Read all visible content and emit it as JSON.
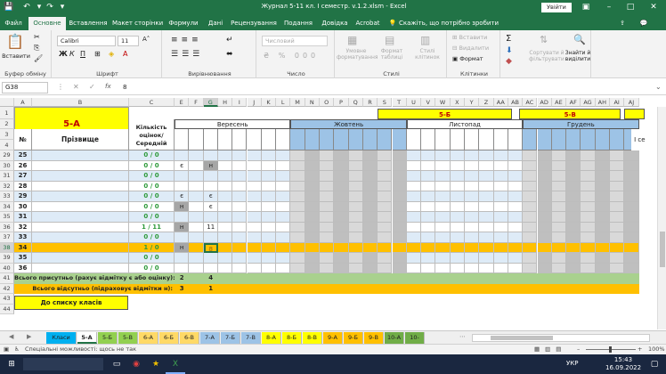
{
  "window": {
    "title": "Журнал 5-11 кл. I семестр. v.1.2.xlsm  -  Excel",
    "signin": "Увійти"
  },
  "ribbon_tabs": [
    "Файл",
    "Основне",
    "Вставлення",
    "Макет сторінки",
    "Формули",
    "Дані",
    "Рецензування",
    "Подання",
    "Довідка",
    "Acrobat"
  ],
  "tell_me": "Скажіть, що потрібно зробити",
  "ribbon": {
    "paste": "Вставити",
    "clipboard": "Буфер обміну",
    "font_name": "Calibri",
    "font_size": "11",
    "font": "Шрифт",
    "alignment": "Вирівнювання",
    "number_format": "Числовий",
    "number": "Число",
    "cond_format": "Умовне форматування",
    "format_table": "Формат таблиці",
    "cell_styles": "Стилі клітинок",
    "styles": "Стилі",
    "insert": "Вставити",
    "delete": "Видалити",
    "format": "Формат",
    "cells": "Клітинки",
    "sort": "Сортувати й фільтрувати",
    "find": "Знайти й виділити"
  },
  "formula_bar": {
    "name_box": "G38",
    "fx": "fx",
    "value": "8"
  },
  "columns": [
    "A",
    "B",
    "C",
    "E",
    "F",
    "G",
    "H",
    "I",
    "J",
    "K",
    "L",
    "M",
    "N",
    "O",
    "P",
    "Q",
    "R",
    "S",
    "T",
    "U",
    "V",
    "W",
    "X",
    "Y",
    "Z",
    "AA",
    "AB",
    "AC",
    "AD",
    "AE",
    "AF",
    "AG",
    "AH",
    "AI",
    "AJ"
  ],
  "header": {
    "class_name": "5-А",
    "num": "№",
    "surname": "Прізвище",
    "count": "Кількість оцінок/Середній бал",
    "months": [
      "Вересень",
      "Жовтень",
      "Листопад",
      "Грудень"
    ],
    "other_classes": [
      "5-Б",
      "5-В"
    ],
    "extra": "І се"
  },
  "rows": [
    {
      "row": "29",
      "num": "25",
      "score": "0 / 0"
    },
    {
      "row": "30",
      "num": "26",
      "score": "0 / 0",
      "e": "є",
      "g": "н"
    },
    {
      "row": "31",
      "num": "27",
      "score": "0 / 0"
    },
    {
      "row": "32",
      "num": "28",
      "score": "0 / 0"
    },
    {
      "row": "33",
      "num": "29",
      "score": "0 / 0",
      "e": "є",
      "g": "є"
    },
    {
      "row": "34",
      "num": "30",
      "score": "0 / 0",
      "e": "н",
      "g": "є"
    },
    {
      "row": "35",
      "num": "31",
      "score": "0 / 0"
    },
    {
      "row": "36",
      "num": "32",
      "score": "1 / 11",
      "e": "н",
      "g": "11"
    },
    {
      "row": "37",
      "num": "33",
      "score": "0 / 0"
    },
    {
      "row": "38",
      "num": "34",
      "score": "1 / 0",
      "e": "н",
      "g": "8"
    },
    {
      "row": "39",
      "num": "35",
      "score": "0 / 0"
    },
    {
      "row": "40",
      "num": "36",
      "score": "0 / 0"
    }
  ],
  "totals": {
    "present_label": "Всього присутньо (рахує відмітку є або оцінку):",
    "present_e": "2",
    "present_g": "4",
    "absent_label": "Всього відсутньо (підраховує відмітки н):",
    "absent_e": "3",
    "absent_g": "1"
  },
  "back_button": "До списку класів",
  "sheet_tabs": [
    "Класи",
    "5-А",
    "5-Б",
    "5-В",
    "6-А",
    "6-Б",
    "6-В",
    "7-А",
    "7-Б",
    "7-В",
    "8-А",
    "8-Б",
    "8-В",
    "9-А",
    "9-Б",
    "9-В",
    "10-А",
    "10-"
  ],
  "status": {
    "text": "Спеціальні можливості: щось не так",
    "zoom": "100%"
  },
  "taskbar": {
    "time": "15:43",
    "date": "16.09.2022",
    "lang": "УКР"
  },
  "colors": {
    "excel_green": "#217346",
    "yellow": "#ffff00",
    "blue_fill": "#9dc3e6",
    "grey_fill": "#d9d9d9",
    "light_blue_row": "#deebf7",
    "orange_row": "#ffc000",
    "green_total": "#a9d18e"
  }
}
